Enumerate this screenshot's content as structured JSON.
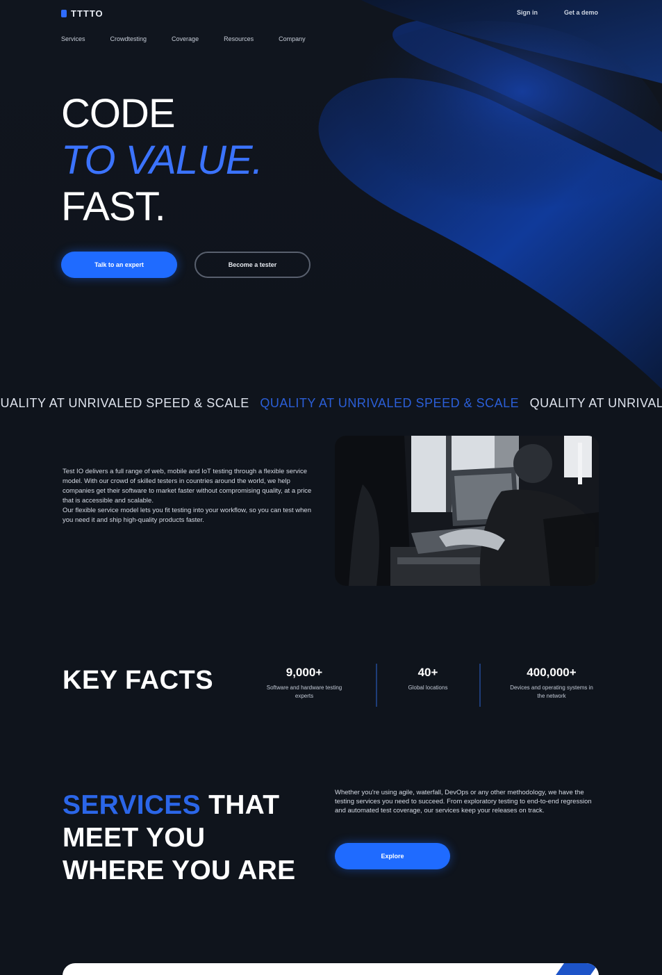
{
  "brand": {
    "logo_text": "TTTTO",
    "accent_color": "#1f6bff",
    "highlight_color": "#3b73ff",
    "background_color": "#0f141c"
  },
  "header": {
    "links": [
      "Sign in",
      "Get a demo"
    ]
  },
  "nav": {
    "items": [
      "Services",
      "Crowdtesting",
      "Coverage",
      "Resources",
      "Company"
    ]
  },
  "hero": {
    "line1": "CODE",
    "line2": "TO VALUE.",
    "line3": "FAST.",
    "primary_cta": "Talk to an expert",
    "secondary_cta": "Become a tester"
  },
  "marquee": {
    "text": "QUALITY AT UNRIVALED SPEED & SCALE"
  },
  "about": {
    "paragraph1": "Test IO delivers a full range of web, mobile and IoT testing through a flexible service model. With our crowd of skilled testers in countries around the world, we help companies get their software to market faster without compromising quality, at a price that is accessible and scalable.",
    "paragraph2": "Our flexible service model lets you fit testing into your workflow, so you can test when you need it and ship high-quality products faster.",
    "photo_icon": "person-at-laptop-photo"
  },
  "key_facts": {
    "title": "KEY FACTS",
    "facts": [
      {
        "value": "9,000+",
        "label": "Software and hardware testing experts"
      },
      {
        "value": "40+",
        "label": "Global locations"
      },
      {
        "value": "400,000+",
        "label": "Devices and operating systems in the network"
      }
    ]
  },
  "services": {
    "title_blue": "SERVICES",
    "title_rest1": " THAT",
    "title_line2": "MEET YOU",
    "title_line3": "WHERE YOU ARE",
    "description": "Whether you're using agile, waterfall, DevOps or any other methodology, we have the testing services you need to succeed. From exploratory testing to end-to-end regression and automated test coverage, our services keep your releases on track.",
    "cta": "Explore"
  }
}
